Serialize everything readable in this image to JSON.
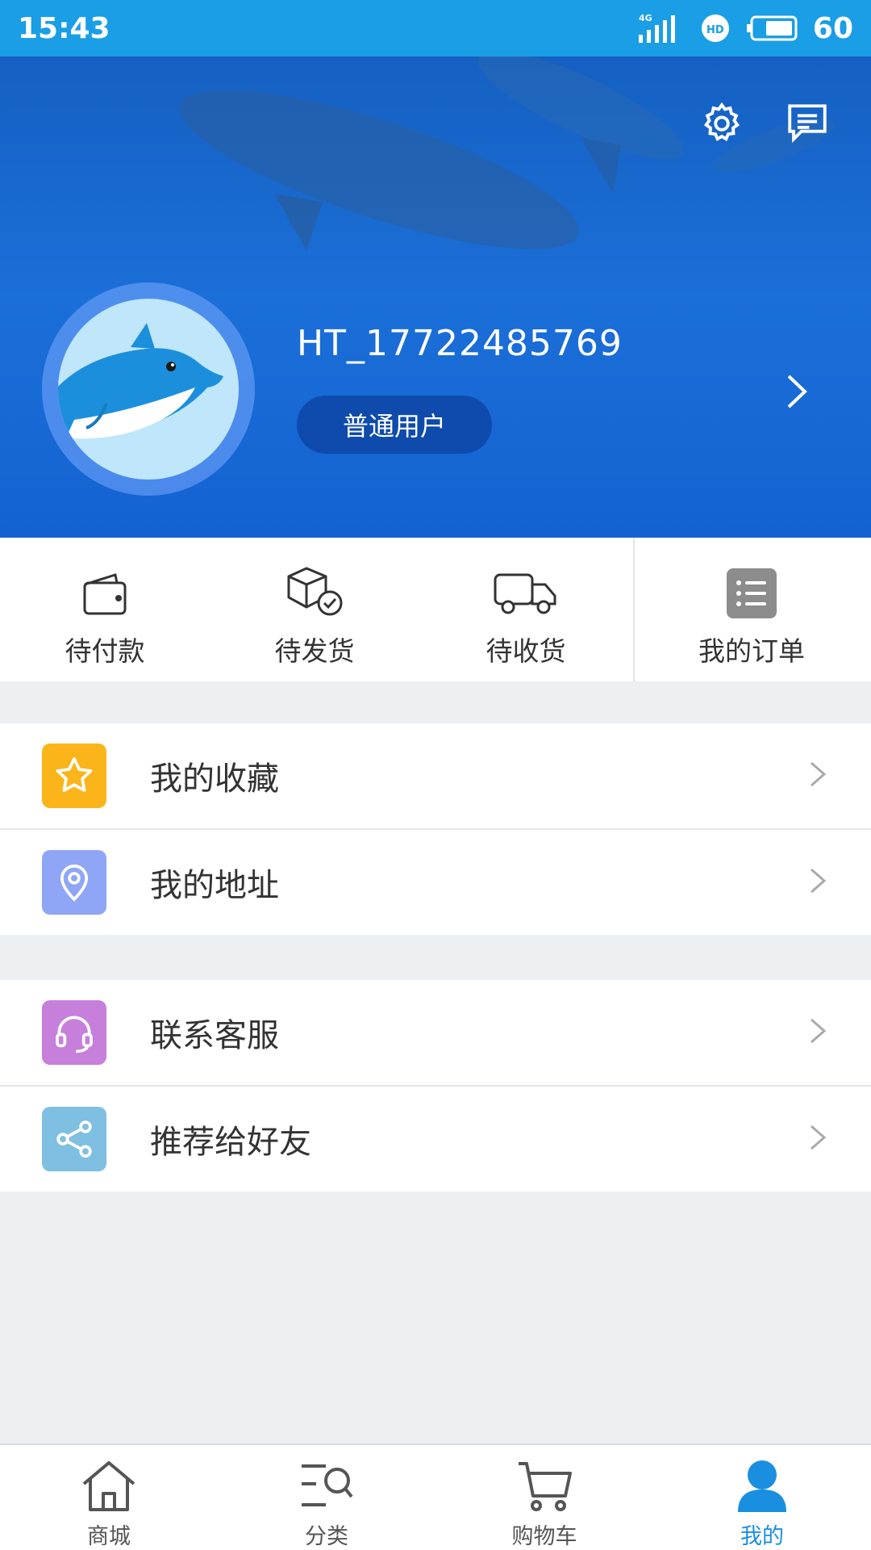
{
  "status_bar": {
    "time": "15:43",
    "network": "4G",
    "battery": "60"
  },
  "profile": {
    "username": "HT_17722485769",
    "user_level": "普通用户"
  },
  "orders": [
    {
      "label": "待付款",
      "icon": "wallet-icon"
    },
    {
      "label": "待发货",
      "icon": "package-check-icon"
    },
    {
      "label": "待收货",
      "icon": "truck-icon"
    },
    {
      "label": "我的订单",
      "icon": "order-list-icon"
    }
  ],
  "menu_group_1": [
    {
      "label": "我的收藏",
      "icon": "star-icon",
      "color": "#fbb51a"
    },
    {
      "label": "我的地址",
      "icon": "location-pin-icon",
      "color": "#8fa5f6"
    }
  ],
  "menu_group_2": [
    {
      "label": "联系客服",
      "icon": "headset-icon",
      "color": "#c77fdc"
    },
    {
      "label": "推荐给好友",
      "icon": "share-icon",
      "color": "#7fbfe2"
    }
  ],
  "tabbar": [
    {
      "label": "商城",
      "icon": "home-icon"
    },
    {
      "label": "分类",
      "icon": "category-search-icon"
    },
    {
      "label": "购物车",
      "icon": "cart-icon"
    },
    {
      "label": "我的",
      "icon": "user-icon",
      "active": true
    }
  ],
  "colors": {
    "accent": "#1a8fe0",
    "status_bar": "#1a9ee6",
    "header": "#1766c9"
  }
}
